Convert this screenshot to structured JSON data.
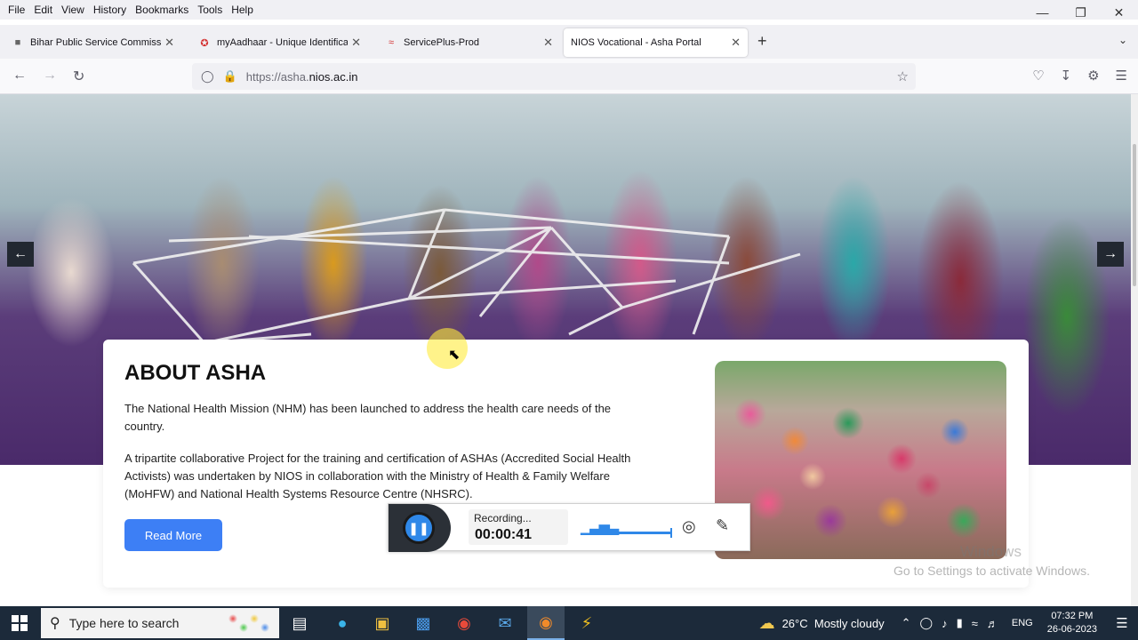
{
  "menubar": [
    "File",
    "Edit",
    "View",
    "History",
    "Bookmarks",
    "Tools",
    "Help"
  ],
  "tabs": [
    {
      "title": "Bihar Public Service Commissio",
      "favicon": "bpsc-favicon"
    },
    {
      "title": "myAadhaar - Unique Identificat",
      "favicon": "aadhaar-favicon"
    },
    {
      "title": "ServicePlus-Prod",
      "favicon": "serviceplus-favicon"
    },
    {
      "title": "NIOS Vocational - Asha Portal",
      "favicon": "none",
      "active": true
    }
  ],
  "url": {
    "scheme": "https://asha.",
    "domain": "nios.ac.in"
  },
  "about": {
    "title": "ABOUT ASHA",
    "p1": "The National Health Mission (NHM) has been launched to address the health care needs of the country.",
    "p2": "A tripartite collaborative Project for the training and certification of ASHAs (Accredited Social Health Activists) was undertaken by NIOS in collaboration with the Ministry of Health & Family Welfare (MoHFW) and National Health Systems Resource Centre (NHSRC).",
    "button": "Read More"
  },
  "carousel": {
    "prev": "←",
    "next": "→"
  },
  "recorder": {
    "status": "Recording...",
    "time": "00:00:41"
  },
  "watermark": {
    "line1": "Windows",
    "line2": "Go to Settings to activate Windows."
  },
  "taskbar": {
    "search_placeholder": "Type here to search",
    "weather_temp": "26°C",
    "weather_text": "Mostly cloudy",
    "lang": "ENG",
    "time": "07:32 PM",
    "date": "26-06-2023"
  },
  "colors": {
    "accent": "#3d7ff5",
    "taskbar": "#1c2a3a",
    "recorder_blue": "#2f88e8"
  }
}
